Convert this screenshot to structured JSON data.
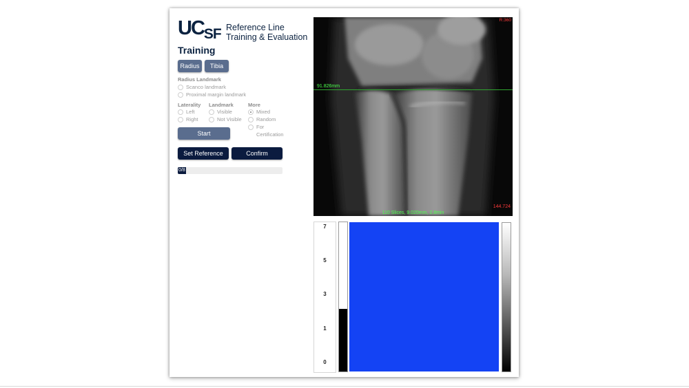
{
  "logo": {
    "mark": "UC",
    "mark_suffix": "SF",
    "title_line1": "Reference Line",
    "title_line2": "Training & Evaluation"
  },
  "section_title": "Training",
  "bone_buttons": [
    "Radius",
    "Tibia"
  ],
  "radius_landmark": {
    "label": "Radius Landmark",
    "options": [
      "Scanco landmark",
      "Proximal margin landmark"
    ]
  },
  "laterality": {
    "label": "Laterality",
    "options": [
      "Left",
      "Right"
    ]
  },
  "landmark": {
    "label": "Landmark",
    "options": [
      "Visible",
      "Not Visible"
    ]
  },
  "more": {
    "label": "More",
    "options": [
      "Mixed",
      "Random",
      "For",
      "Certification"
    ],
    "selected": "Mixed"
  },
  "start_label": "Start",
  "set_reference_label": "Set Reference Line",
  "confirm_label": "Confirm",
  "progress": {
    "text": "0/8",
    "fraction": 0.08
  },
  "viewer": {
    "reference_label": "91.826mm",
    "corner_top": "R:360",
    "corner_bottom": "144.724",
    "footer": "110 Slices, 9.020mm, 2.8min"
  },
  "histogram": {
    "ticks": [
      "7",
      "5",
      "3",
      "1",
      "0"
    ],
    "fill_fraction": 0.42
  },
  "colors": {
    "navy": "#0b1b3f",
    "slate_button": "#5a6d8e",
    "panel_blue": "#1443f4",
    "reference_green": "#2fa52f"
  }
}
